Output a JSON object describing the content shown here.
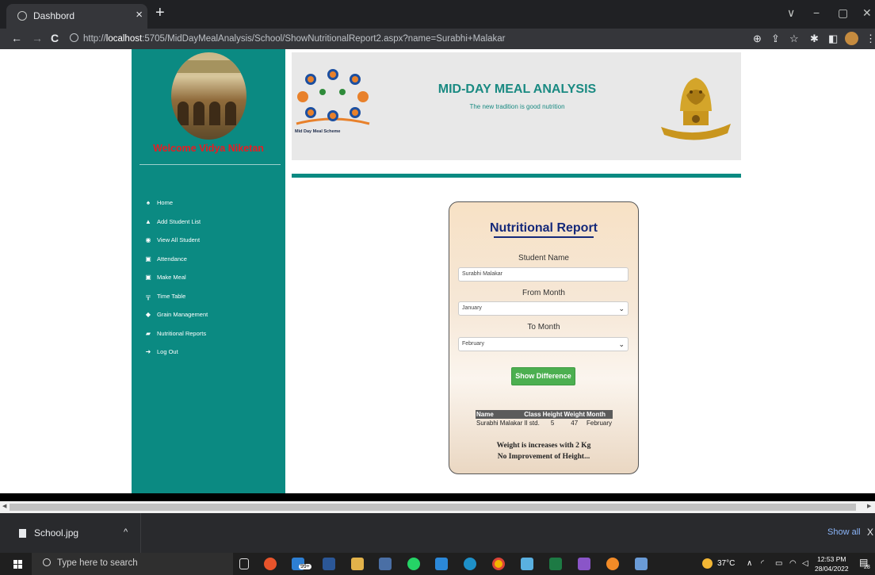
{
  "browser": {
    "tab_title": "Dashbord",
    "tab_close": "×",
    "new_tab": "+",
    "nav": {
      "back": "←",
      "forward": "→",
      "reload": "C"
    },
    "url_prefix": "http://",
    "url_host": "localhost",
    "url_rest": ":5705/MidDayMealAnalysis/School/ShowNutritionalReport2.aspx?name=Surabhi+Malakar",
    "window_controls": {
      "chevron": "∨",
      "minimize": "−",
      "maximize": "▢",
      "close": "✕"
    }
  },
  "sidebar": {
    "welcome": "Welcome Vidya Niketan",
    "items": [
      {
        "label": "Home",
        "icon": "home-icon",
        "glyph": "♠"
      },
      {
        "label": "Add Student List",
        "icon": "add-user-icon",
        "glyph": "▲"
      },
      {
        "label": "View All Student",
        "icon": "eye-icon",
        "glyph": "◉"
      },
      {
        "label": "Attendance",
        "icon": "calendar-icon",
        "glyph": "▣"
      },
      {
        "label": "Make Meal",
        "icon": "meal-icon",
        "glyph": "▣"
      },
      {
        "label": "Time Table",
        "icon": "timetable-icon",
        "glyph": "╦"
      },
      {
        "label": "Grain Management",
        "icon": "grain-icon",
        "glyph": "◆"
      },
      {
        "label": "Nutritional Reports",
        "icon": "folder-open-icon",
        "glyph": "▰"
      },
      {
        "label": "Log Out",
        "icon": "logout-icon",
        "glyph": "➜"
      }
    ]
  },
  "header": {
    "logo_caption": "Mid Day Meal Scheme",
    "title": "MID-DAY MEAL ANALYSIS",
    "subtitle": "The new tradition is good nutrition"
  },
  "report": {
    "title": "Nutritional Report",
    "student_name_label": "Student Name",
    "student_name_value": "Surabhi Malakar",
    "from_month_label": "From Month",
    "from_month_value": "January",
    "to_month_label": "To Month",
    "to_month_value": "February",
    "button_label": "Show Difference",
    "table": {
      "headers": [
        "Name",
        "Class",
        "Height",
        "Weight",
        "Month"
      ],
      "rows": [
        [
          "Surabhi Malakar",
          "II std.",
          "5",
          "47",
          "February"
        ]
      ]
    },
    "message_1": "Weight is increases with 2 Kg",
    "message_2": "No Improvement of Height..."
  },
  "downloads": {
    "file_name": "School.jpg",
    "caret": "^",
    "show_all": "Show all",
    "close": "X"
  },
  "taskbar": {
    "search_placeholder": "Type here to search",
    "mail_badge": "99+",
    "weather": "37°C",
    "time": "12:53 PM",
    "date": "28/04/2022",
    "notifications": "28"
  },
  "colors": {
    "sidebar": "#0b8a82",
    "title_teal": "#1a8a82",
    "report_title": "#15297a",
    "button_green": "#4caf50",
    "welcome_red": "#e81c22"
  }
}
